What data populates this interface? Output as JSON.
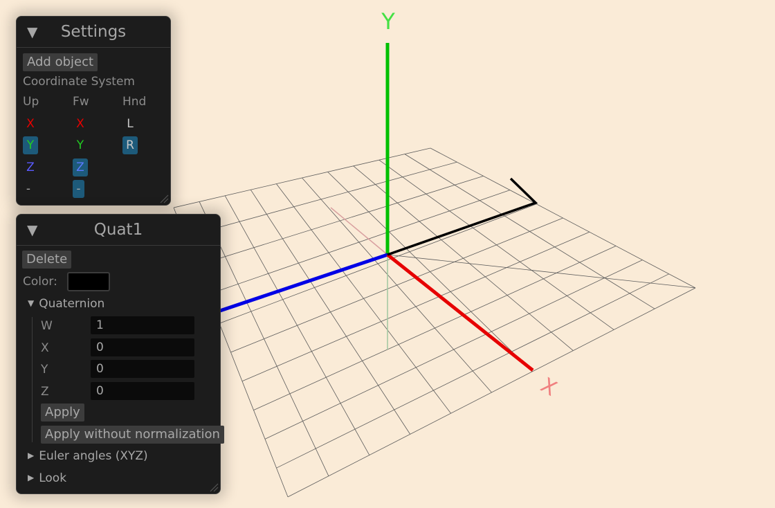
{
  "axis_labels": {
    "y": "Y",
    "x": "X"
  },
  "settings": {
    "title": "Settings",
    "add_object": "Add object",
    "coord_label": "Coordinate System",
    "col_up": "Up",
    "col_fw": "Fw",
    "col_hnd": "Hnd",
    "up_options": [
      "X",
      "Y",
      "Z",
      "-"
    ],
    "fw_options": [
      "X",
      "Y",
      "Z",
      "-"
    ],
    "hnd_options": [
      "L",
      "R"
    ],
    "selected": {
      "up": "Y",
      "fw": "Z",
      "hnd": "R"
    }
  },
  "quat": {
    "title": "Quat1",
    "delete": "Delete",
    "color_label": "Color:",
    "color_value": "#000000",
    "quaternion_header": "Quaternion",
    "fields": [
      {
        "label": "W",
        "value": "1"
      },
      {
        "label": "X",
        "value": "0"
      },
      {
        "label": "Y",
        "value": "0"
      },
      {
        "label": "Z",
        "value": "0"
      }
    ],
    "apply": "Apply",
    "apply_no_norm": "Apply without normalization",
    "euler_header": "Euler angles (XYZ)",
    "look_header": "Look"
  },
  "colors": {
    "background": "#faebd7",
    "axis_x": "#e60000",
    "axis_y": "#00c000",
    "axis_z": "#0000e6",
    "selected": "#1d5a7a",
    "panel": "#1c1c1c"
  }
}
